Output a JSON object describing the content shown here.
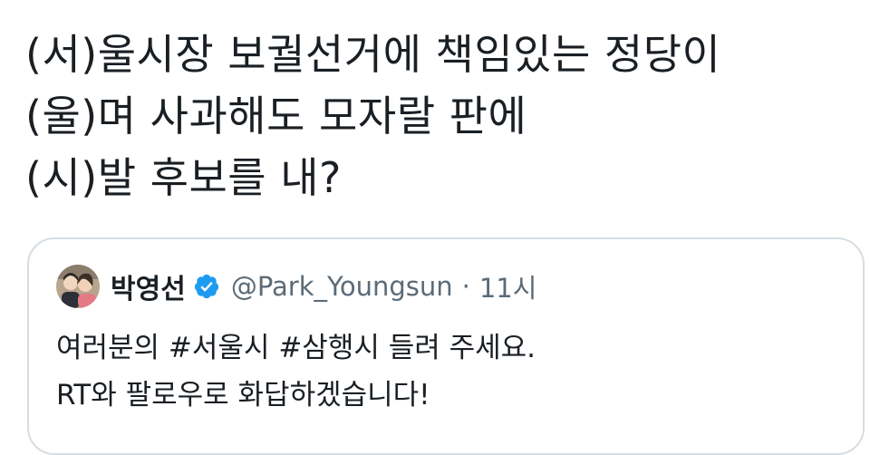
{
  "tweet": {
    "lines": [
      "(서)울시장 보궐선거에 책임있는 정당이",
      "(울)며 사과해도 모자랄 판에",
      "(시)발 후보를 내?"
    ]
  },
  "quoted_tweet": {
    "display_name": "박영선",
    "handle": "@Park_Youngsun",
    "separator": "·",
    "timestamp": "11시",
    "avatar_icon": "profile-photo",
    "verified_icon": "verified-badge-icon",
    "verified_color": "#1d9bf0",
    "lines": [
      "여러분의 #서울시 #삼행시 들려 주세요.",
      "RT와 팔로우로 화답하겠습니다!"
    ]
  }
}
